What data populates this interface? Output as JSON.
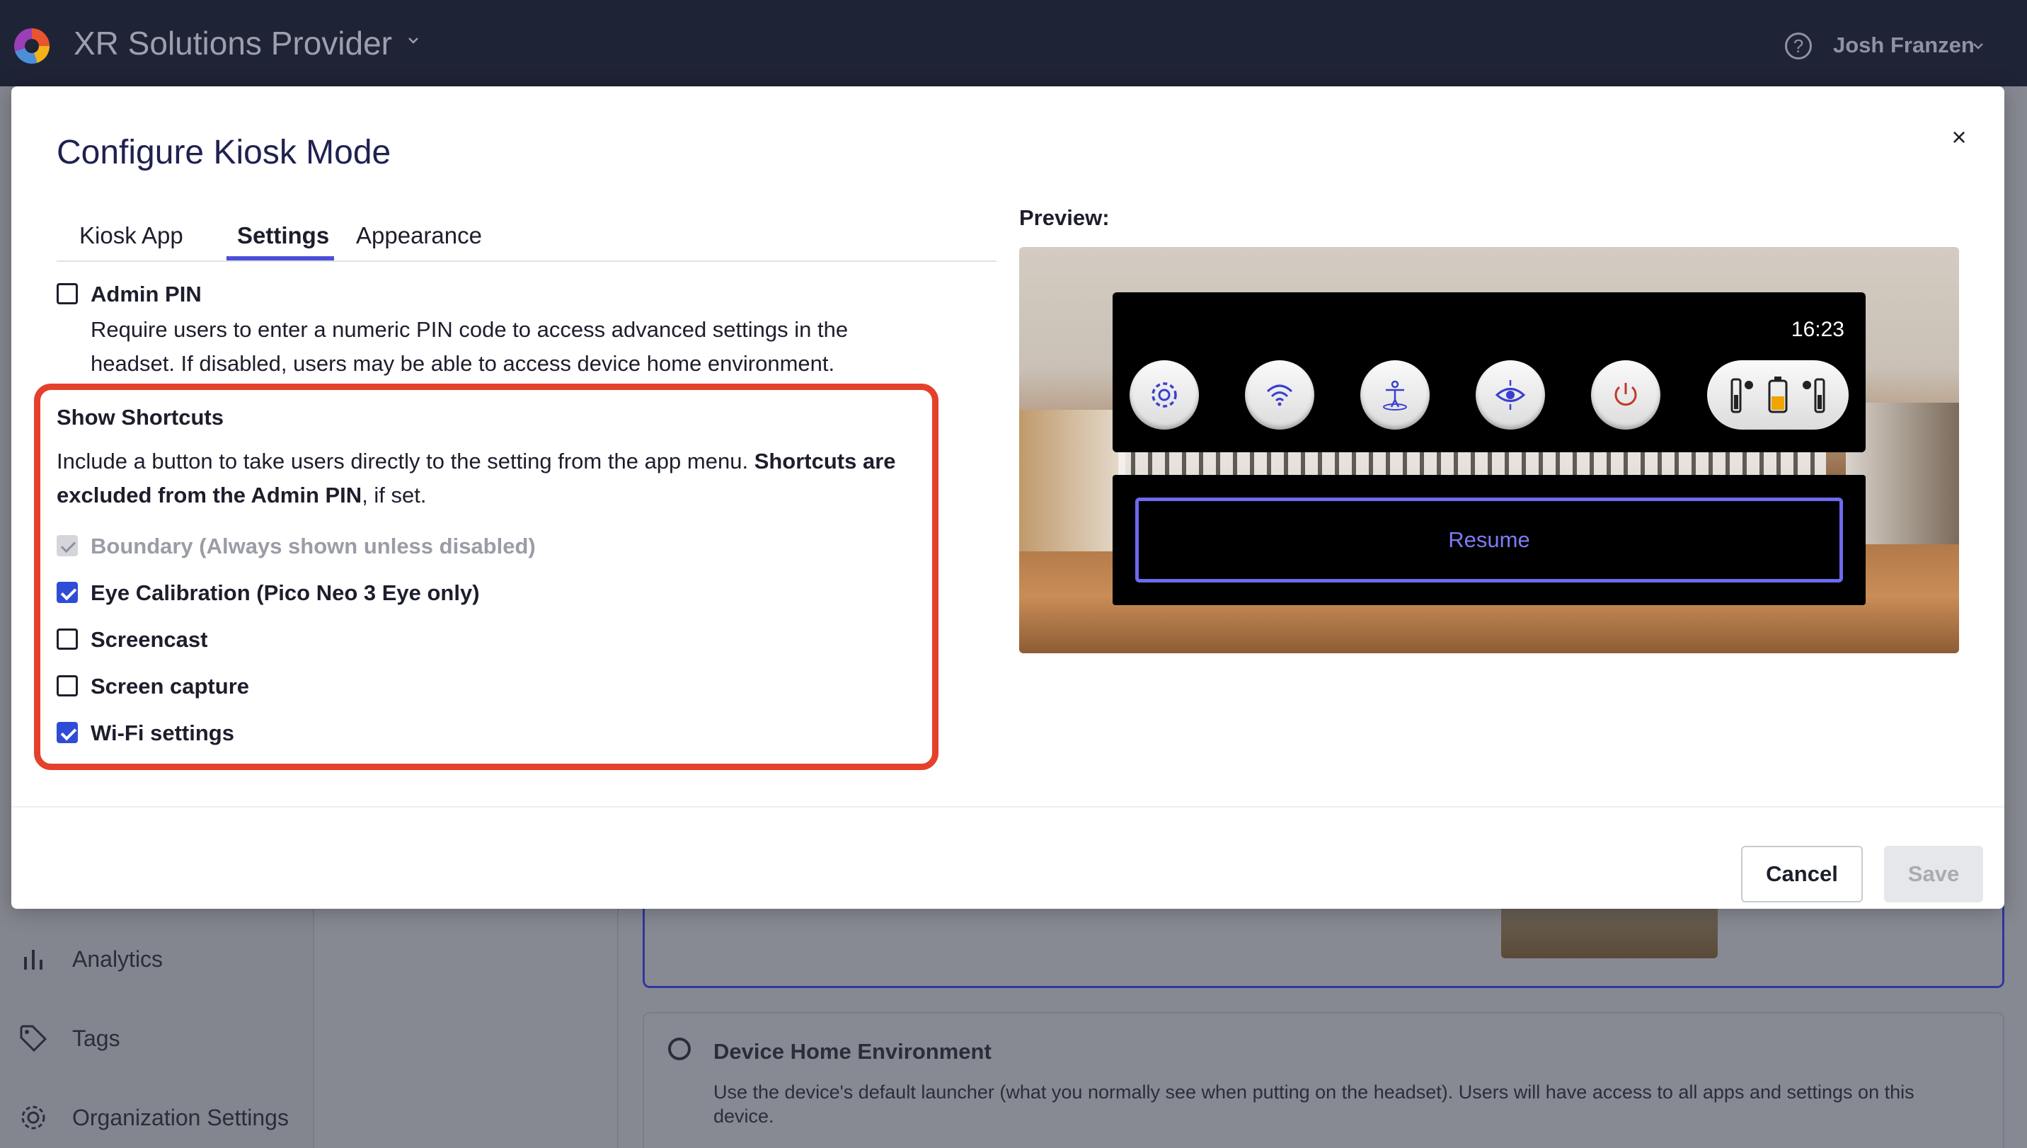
{
  "topbar": {
    "org_name": "XR Solutions Provider",
    "help_glyph": "?",
    "user_name": "Josh Franzen",
    "icons": [
      "app-logo",
      "chevron-down-icon",
      "help-icon"
    ]
  },
  "sidebar": {
    "items": [
      {
        "label": "Analytics",
        "icon": "bar-chart-icon"
      },
      {
        "label": "Tags",
        "icon": "tag-icon"
      },
      {
        "label": "Organization Settings",
        "icon": "gear-icon"
      }
    ]
  },
  "background": {
    "home_env_title": "Device Home Environment",
    "home_env_desc": "Use the device's default launcher (what you normally see when putting on the headset). Users will have access to all apps and settings on this device."
  },
  "modal": {
    "title": "Configure Kiosk Mode",
    "close_glyph": "×",
    "tabs": [
      {
        "label": "Kiosk App",
        "active": false
      },
      {
        "label": "Settings",
        "active": true
      },
      {
        "label": "Appearance",
        "active": false
      }
    ],
    "admin_pin": {
      "label": "Admin PIN",
      "checked": false,
      "desc_line1": "Require users to enter a numeric PIN code to access advanced settings in the",
      "desc_line2": "headset. If disabled, users may be able to access device home environment."
    },
    "shortcuts": {
      "title": "Show Shortcuts",
      "desc_part1": "Include a button to take users directly to the setting from the app menu. ",
      "desc_bold1": "Shortcuts are",
      "desc_bold2": "excluded from the Admin PIN",
      "desc_part2": ", if set.",
      "options": [
        {
          "label": "Boundary (Always shown unless disabled)",
          "checked": true,
          "disabled": true
        },
        {
          "label": "Eye Calibration (Pico Neo 3 Eye only)",
          "checked": true,
          "disabled": false
        },
        {
          "label": "Screencast",
          "checked": false,
          "disabled": false
        },
        {
          "label": "Screen capture",
          "checked": false,
          "disabled": false
        },
        {
          "label": "Wi-Fi settings",
          "checked": true,
          "disabled": false
        }
      ]
    },
    "preview": {
      "label": "Preview:",
      "time": "16:23",
      "quick_buttons": [
        "gear-icon",
        "wifi-icon",
        "boundary-person-icon",
        "eye-calibration-icon",
        "power-icon"
      ],
      "battery_icons": [
        "controller-left-battery-icon",
        "headset-battery-icon",
        "controller-right-battery-icon"
      ],
      "resume_label": "Resume"
    },
    "footer": {
      "cancel_label": "Cancel",
      "save_label": "Save"
    }
  },
  "colors": {
    "topbar_bg": "#1f2336",
    "accent": "#4b4fd8",
    "checkbox_checked": "#2f4cd6",
    "highlight_border": "#e5402b",
    "resume_border": "#6c6aee"
  }
}
